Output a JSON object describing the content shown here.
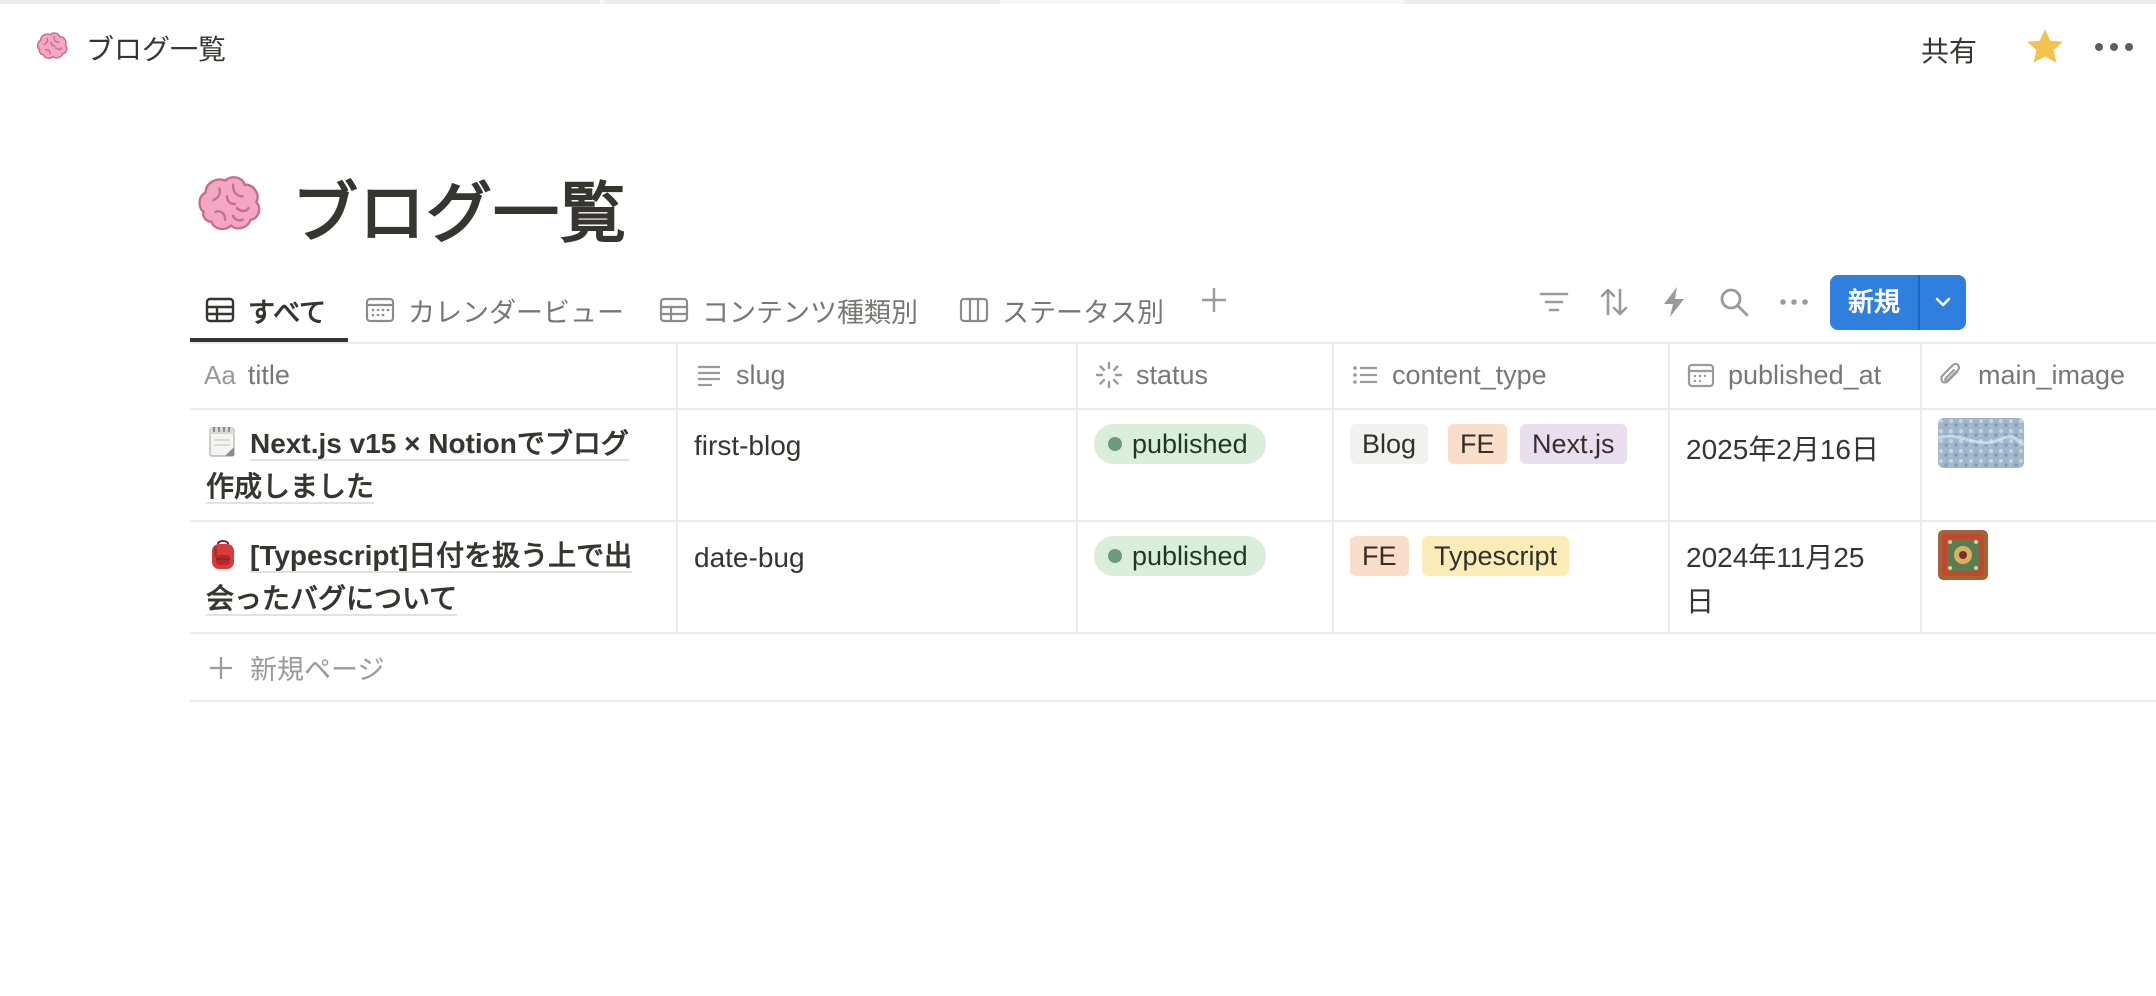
{
  "breadcrumb": {
    "title": "ブログ一覧",
    "icon": "brain-emoji-icon"
  },
  "topbar": {
    "share_label": "共有",
    "star_color": "#f2c14e"
  },
  "page": {
    "title": "ブログ一覧",
    "icon": "brain-emoji-icon"
  },
  "views": [
    {
      "label": "すべて",
      "icon": "table-icon",
      "active": true
    },
    {
      "label": "カレンダービュー",
      "icon": "calendar-icon",
      "active": false
    },
    {
      "label": "コンテンツ種類別",
      "icon": "table-icon",
      "active": false
    },
    {
      "label": "ステータス別",
      "icon": "board-icon",
      "active": false
    }
  ],
  "toolbar": {
    "new_label": "新規",
    "accent": "#2f7fdf"
  },
  "columns": [
    {
      "label": "title",
      "icon": "text-aa-icon",
      "icon_text": "Aa"
    },
    {
      "label": "slug",
      "icon": "text-lines-icon"
    },
    {
      "label": "status",
      "icon": "status-spinner-icon"
    },
    {
      "label": "content_type",
      "icon": "multi-select-icon"
    },
    {
      "label": "published_at",
      "icon": "date-icon"
    },
    {
      "label": "main_image",
      "icon": "paperclip-icon"
    }
  ],
  "rows": [
    {
      "title_line1": "Next.js v15 × Notionでブログ",
      "title_line2": "作成しました",
      "title_icon": "notepad-emoji-icon",
      "slug": "first-blog",
      "status": "published",
      "tags": [
        {
          "label": "Blog",
          "color": "#f1f1ef"
        },
        {
          "label": "FE",
          "color": "#fadec9"
        },
        {
          "label": "Next.js",
          "color": "#e8deee"
        }
      ],
      "date_line1": "2025年2月16日",
      "date_line2": "",
      "image": "blue-texture-thumbnail"
    },
    {
      "title_line1": "[Typescript]日付を扱う上で出",
      "title_line2": "会ったバグについて",
      "title_icon": "backpack-emoji-icon",
      "slug": "date-bug",
      "status": "published",
      "tags": [
        {
          "label": "FE",
          "color": "#fadec9"
        },
        {
          "label": "Typescript",
          "color": "#fbecb8"
        }
      ],
      "date_line1": "2024年11月25",
      "date_line2": "日",
      "image": "red-pattern-thumbnail"
    }
  ],
  "new_page_label": "新規ページ",
  "status_color": "#dbeddb"
}
